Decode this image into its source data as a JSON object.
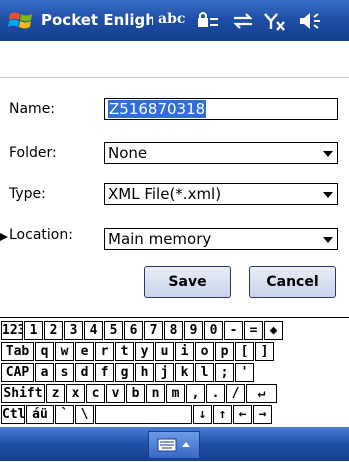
{
  "titlebar": {
    "title": "Pocket Enlight",
    "status_abc": "abc"
  },
  "form": {
    "name_label": "Name:",
    "name_value": "Z516870318",
    "folder_label": "Folder:",
    "folder_value": "None",
    "type_label": "Type:",
    "type_value": "XML File(*.xml)",
    "location_label": "Location:",
    "location_value": "Main memory"
  },
  "buttons": {
    "save": "Save",
    "cancel": "Cancel"
  },
  "keyboard": {
    "rows": [
      [
        "123",
        "1",
        "2",
        "3",
        "4",
        "5",
        "6",
        "7",
        "8",
        "9",
        "0",
        "-",
        "=",
        "◆"
      ],
      [
        "Tab",
        "q",
        "w",
        "e",
        "r",
        "t",
        "y",
        "u",
        "i",
        "o",
        "p",
        "[",
        "]"
      ],
      [
        "CAP",
        "a",
        "s",
        "d",
        "f",
        "g",
        "h",
        "j",
        "k",
        "l",
        ";",
        "'"
      ],
      [
        "Shift",
        "z",
        "x",
        "c",
        "v",
        "b",
        "n",
        "m",
        ",",
        ".",
        "/",
        "↵"
      ],
      [
        "Ctl",
        "áü",
        "`",
        "\\",
        "",
        "↓",
        "↑",
        "←",
        "→"
      ]
    ]
  }
}
